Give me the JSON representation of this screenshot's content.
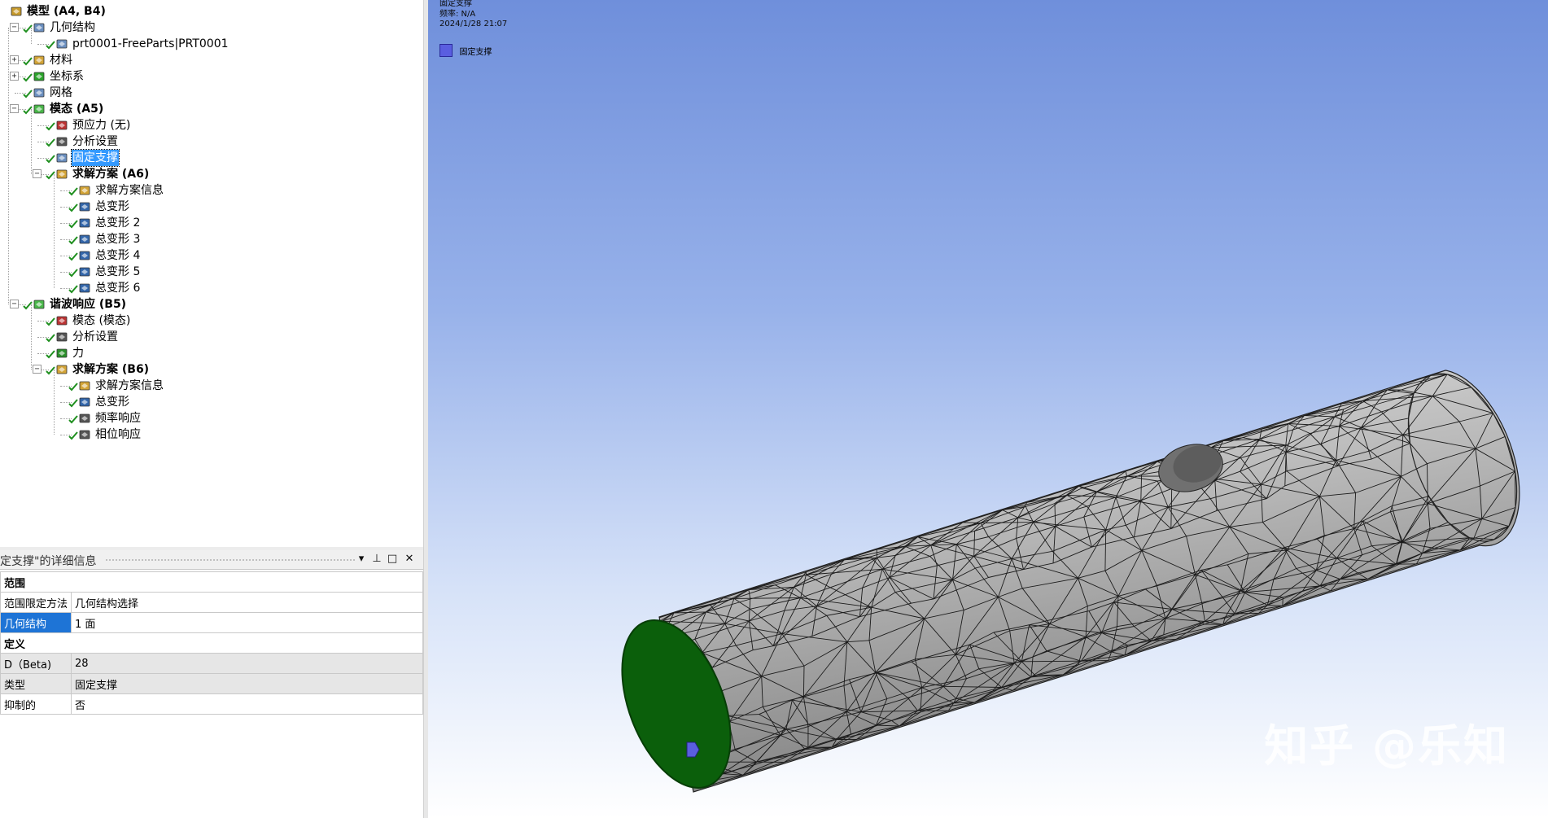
{
  "tree": {
    "items": [
      {
        "label": "模型 (A4, B4)",
        "level": 0,
        "bold": true,
        "expander": "",
        "icon": "model-icon",
        "check": false,
        "icon_color": "#c79a2b"
      },
      {
        "label": "几何结构",
        "level": 1,
        "bold": false,
        "expander": "minus",
        "icon": "geometry-icon",
        "check": true,
        "icon_color": "#6b8fbf"
      },
      {
        "label": "prt0001-FreeParts|PRT0001",
        "level": 2,
        "bold": false,
        "expander": "",
        "icon": "part-icon",
        "check": true,
        "icon_color": "#6b8fbf"
      },
      {
        "label": "材料",
        "level": 1,
        "bold": false,
        "expander": "plus",
        "icon": "materials-icon",
        "check": true,
        "icon_color": "#d3a437"
      },
      {
        "label": "坐标系",
        "level": 1,
        "bold": false,
        "expander": "plus",
        "icon": "coordinate-systems-icon",
        "check": true,
        "icon_color": "#2aa32a"
      },
      {
        "label": "网格",
        "level": 1,
        "bold": false,
        "expander": "",
        "icon": "mesh-icon",
        "check": true,
        "icon_color": "#6b8fbf"
      },
      {
        "label": "模态 (A5)",
        "level": 1,
        "bold": true,
        "expander": "minus",
        "icon": "modal-analysis-icon",
        "check": true,
        "icon_color": "#49b649"
      },
      {
        "label": "预应力 (无)",
        "level": 2,
        "bold": false,
        "expander": "",
        "icon": "prestress-icon",
        "check": true,
        "icon_color": "#b33"
      },
      {
        "label": "分析设置",
        "level": 2,
        "bold": false,
        "expander": "",
        "icon": "analysis-settings-icon",
        "check": true,
        "icon_color": "#555"
      },
      {
        "label": "固定支撑",
        "level": 2,
        "bold": false,
        "expander": "",
        "icon": "fixed-support-icon",
        "check": true,
        "icon_color": "#6b8fbf",
        "selected": true
      },
      {
        "label": "求解方案 (A6)",
        "level": 2,
        "bold": true,
        "expander": "minus",
        "icon": "solution-icon",
        "check": true,
        "icon_color": "#d3a437"
      },
      {
        "label": "求解方案信息",
        "level": 3,
        "bold": false,
        "expander": "",
        "icon": "solution-info-icon",
        "check": true,
        "icon_color": "#d3a437"
      },
      {
        "label": "总变形",
        "level": 3,
        "bold": false,
        "expander": "",
        "icon": "total-deformation-icon",
        "check": true,
        "icon_color": "#36a"
      },
      {
        "label": "总变形 2",
        "level": 3,
        "bold": false,
        "expander": "",
        "icon": "total-deformation-icon",
        "check": true,
        "icon_color": "#36a"
      },
      {
        "label": "总变形 3",
        "level": 3,
        "bold": false,
        "expander": "",
        "icon": "total-deformation-icon",
        "check": true,
        "icon_color": "#36a"
      },
      {
        "label": "总变形 4",
        "level": 3,
        "bold": false,
        "expander": "",
        "icon": "total-deformation-icon",
        "check": true,
        "icon_color": "#36a"
      },
      {
        "label": "总变形 5",
        "level": 3,
        "bold": false,
        "expander": "",
        "icon": "total-deformation-icon",
        "check": true,
        "icon_color": "#36a"
      },
      {
        "label": "总变形 6",
        "level": 3,
        "bold": false,
        "expander": "",
        "icon": "total-deformation-icon",
        "check": true,
        "icon_color": "#36a"
      },
      {
        "label": "谐波响应 (B5)",
        "level": 1,
        "bold": true,
        "expander": "minus",
        "icon": "harmonic-response-icon",
        "check": true,
        "icon_color": "#49b649"
      },
      {
        "label": "模态 (模态)",
        "level": 2,
        "bold": false,
        "expander": "",
        "icon": "modal-link-icon",
        "check": true,
        "icon_color": "#b33"
      },
      {
        "label": "分析设置",
        "level": 2,
        "bold": false,
        "expander": "",
        "icon": "analysis-settings-icon",
        "check": true,
        "icon_color": "#555"
      },
      {
        "label": "力",
        "level": 2,
        "bold": false,
        "expander": "",
        "icon": "force-icon",
        "check": true,
        "icon_color": "#2a8f2a"
      },
      {
        "label": "求解方案 (B6)",
        "level": 2,
        "bold": true,
        "expander": "minus",
        "icon": "solution-icon",
        "check": true,
        "icon_color": "#d3a437"
      },
      {
        "label": "求解方案信息",
        "level": 3,
        "bold": false,
        "expander": "",
        "icon": "solution-info-icon",
        "check": true,
        "icon_color": "#d3a437"
      },
      {
        "label": "总变形",
        "level": 3,
        "bold": false,
        "expander": "",
        "icon": "total-deformation-icon",
        "check": true,
        "icon_color": "#36a"
      },
      {
        "label": "频率响应",
        "level": 3,
        "bold": false,
        "expander": "",
        "icon": "frequency-response-icon",
        "check": true,
        "icon_color": "#555"
      },
      {
        "label": "相位响应",
        "level": 3,
        "bold": false,
        "expander": "",
        "icon": "phase-response-icon",
        "check": true,
        "icon_color": "#555"
      }
    ]
  },
  "details": {
    "title": "定支撑\"的详细信息",
    "rows": [
      {
        "type": "section",
        "label": "范围"
      },
      {
        "type": "row",
        "key": "范围限定方法",
        "value": "几何结构选择",
        "grey": false,
        "key_selected": false
      },
      {
        "type": "row",
        "key": "几何结构",
        "value": "1 面",
        "grey": false,
        "key_selected": true
      },
      {
        "type": "section",
        "label": "定义"
      },
      {
        "type": "row",
        "key": "D（Beta)",
        "value": "28",
        "grey": true,
        "key_selected": false
      },
      {
        "type": "row",
        "key": "类型",
        "value": "固定支撑",
        "grey": true,
        "key_selected": false
      },
      {
        "type": "row",
        "key": "抑制的",
        "value": "否",
        "grey": false,
        "key_selected": false
      }
    ],
    "buttons": {
      "dropdown": "▾",
      "pin": "⊥",
      "maximize": "□",
      "close": "✕"
    }
  },
  "viewport": {
    "line1": "固定支撑",
    "line2": "频率: N/A",
    "line3": "2024/1/28 21:07",
    "legend_label": "固定支撑",
    "legend_color": "#5a5ee0",
    "watermark": "知乎 @乐知",
    "support_face_color": "#0b5f0b",
    "marker_color": "#5a5ee0"
  }
}
